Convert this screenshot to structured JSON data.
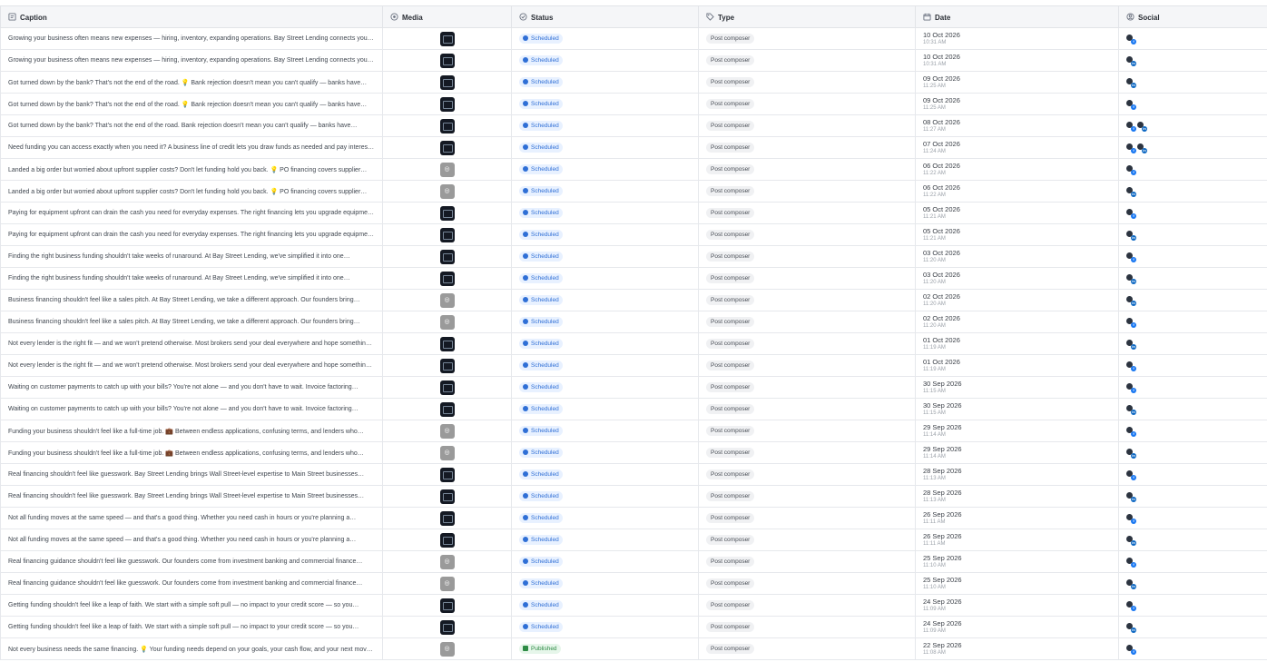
{
  "columns": {
    "caption": "Caption",
    "media": "Media",
    "status": "Status",
    "type": "Type",
    "date": "Date",
    "social": "Social"
  },
  "rows": [
    {
      "caption": "Growing your business often means new expenses — hiring, inventory, expanding operations. Bay Street Lending connects you…",
      "media": "image",
      "status": "Scheduled",
      "type": "Post composer",
      "date": "10 Oct 2026",
      "time": "10:31 AM",
      "social": [
        "facebook"
      ]
    },
    {
      "caption": "Growing your business often means new expenses — hiring, inventory, expanding operations. Bay Street Lending connects you…",
      "media": "image",
      "status": "Scheduled",
      "type": "Post composer",
      "date": "10 Oct 2026",
      "time": "10:31 AM",
      "social": [
        "linkedin"
      ]
    },
    {
      "caption": "Got turned down by the bank? That's not the end of the road. 💡 Bank rejection doesn't mean you can't qualify — banks have…",
      "media": "image",
      "status": "Scheduled",
      "type": "Post composer",
      "date": "09 Oct 2026",
      "time": "11:25 AM",
      "social": [
        "linkedin"
      ]
    },
    {
      "caption": "Got turned down by the bank? That's not the end of the road. 💡 Bank rejection doesn't mean you can't qualify — banks have…",
      "media": "image",
      "status": "Scheduled",
      "type": "Post composer",
      "date": "09 Oct 2026",
      "time": "11:25 AM",
      "social": [
        "facebook"
      ]
    },
    {
      "caption": "Got turned down by the bank? That's not the end of the road. Bank rejection doesn't mean you can't qualify — banks have…",
      "media": "image",
      "status": "Scheduled",
      "type": "Post composer",
      "date": "08 Oct 2026",
      "time": "11:27 AM",
      "social": [
        "facebook",
        "linkedin"
      ]
    },
    {
      "caption": "Need funding you can access exactly when you need it? A business line of credit lets you draw funds as needed and pay interest…",
      "media": "image",
      "status": "Scheduled",
      "type": "Post composer",
      "date": "07 Oct 2026",
      "time": "11:24 AM",
      "social": [
        "facebook",
        "linkedin"
      ]
    },
    {
      "caption": "Landed a big order but worried about upfront supplier costs? Don't let funding hold you back. 💡 PO financing covers supplier…",
      "media": "video",
      "status": "Scheduled",
      "type": "Post composer",
      "date": "06 Oct 2026",
      "time": "11:22 AM",
      "social": [
        "facebook"
      ]
    },
    {
      "caption": "Landed a big order but worried about upfront supplier costs? Don't let funding hold you back. 💡 PO financing covers supplier…",
      "media": "video",
      "status": "Scheduled",
      "type": "Post composer",
      "date": "06 Oct 2026",
      "time": "11:22 AM",
      "social": [
        "linkedin"
      ]
    },
    {
      "caption": "Paying for equipment upfront can drain the cash you need for everyday expenses. The right financing lets you upgrade equipment…",
      "media": "image",
      "status": "Scheduled",
      "type": "Post composer",
      "date": "05 Oct 2026",
      "time": "11:21 AM",
      "social": [
        "facebook"
      ]
    },
    {
      "caption": "Paying for equipment upfront can drain the cash you need for everyday expenses. The right financing lets you upgrade equipment…",
      "media": "image",
      "status": "Scheduled",
      "type": "Post composer",
      "date": "05 Oct 2026",
      "time": "11:21 AM",
      "social": [
        "linkedin"
      ]
    },
    {
      "caption": "Finding the right business funding shouldn't take weeks of runaround. At Bay Street Lending, we've simplified it into one…",
      "media": "image",
      "status": "Scheduled",
      "type": "Post composer",
      "date": "03 Oct 2026",
      "time": "11:20 AM",
      "social": [
        "facebook"
      ]
    },
    {
      "caption": "Finding the right business funding shouldn't take weeks of runaround. At Bay Street Lending, we've simplified it into one…",
      "media": "image",
      "status": "Scheduled",
      "type": "Post composer",
      "date": "03 Oct 2026",
      "time": "11:20 AM",
      "social": [
        "linkedin"
      ]
    },
    {
      "caption": "Business financing shouldn't feel like a sales pitch. At Bay Street Lending, we take a different approach. Our founders bring…",
      "media": "video",
      "status": "Scheduled",
      "type": "Post composer",
      "date": "02 Oct 2026",
      "time": "11:20 AM",
      "social": [
        "linkedin"
      ]
    },
    {
      "caption": "Business financing shouldn't feel like a sales pitch. At Bay Street Lending, we take a different approach. Our founders bring…",
      "media": "video",
      "status": "Scheduled",
      "type": "Post composer",
      "date": "02 Oct 2026",
      "time": "11:20 AM",
      "social": [
        "facebook"
      ]
    },
    {
      "caption": "Not every lender is the right fit — and we won't pretend otherwise. Most brokers send your deal everywhere and hope something…",
      "media": "image",
      "status": "Scheduled",
      "type": "Post composer",
      "date": "01 Oct 2026",
      "time": "11:19 AM",
      "social": [
        "linkedin"
      ]
    },
    {
      "caption": "Not every lender is the right fit — and we won't pretend otherwise. Most brokers send your deal everywhere and hope something…",
      "media": "image",
      "status": "Scheduled",
      "type": "Post composer",
      "date": "01 Oct 2026",
      "time": "11:19 AM",
      "social": [
        "facebook"
      ]
    },
    {
      "caption": "Waiting on customer payments to catch up with your bills? You're not alone — and you don't have to wait. Invoice factoring…",
      "media": "image",
      "status": "Scheduled",
      "type": "Post composer",
      "date": "30 Sep 2026",
      "time": "11:15 AM",
      "social": [
        "facebook"
      ]
    },
    {
      "caption": "Waiting on customer payments to catch up with your bills? You're not alone — and you don't have to wait. Invoice factoring…",
      "media": "image",
      "status": "Scheduled",
      "type": "Post composer",
      "date": "30 Sep 2026",
      "time": "11:15 AM",
      "social": [
        "linkedin"
      ]
    },
    {
      "caption": "Funding your business shouldn't feel like a full-time job. 💼 Between endless applications, confusing terms, and lenders who…",
      "media": "video",
      "status": "Scheduled",
      "type": "Post composer",
      "date": "29 Sep 2026",
      "time": "11:14 AM",
      "social": [
        "facebook"
      ]
    },
    {
      "caption": "Funding your business shouldn't feel like a full-time job. 💼 Between endless applications, confusing terms, and lenders who…",
      "media": "video",
      "status": "Scheduled",
      "type": "Post composer",
      "date": "29 Sep 2026",
      "time": "11:14 AM",
      "social": [
        "linkedin"
      ]
    },
    {
      "caption": "Real financing shouldn't feel like guesswork. Bay Street Lending brings Wall Street-level expertise to Main Street businesses…",
      "media": "image",
      "status": "Scheduled",
      "type": "Post composer",
      "date": "28 Sep 2026",
      "time": "11:13 AM",
      "social": [
        "facebook"
      ]
    },
    {
      "caption": "Real financing shouldn't feel like guesswork. Bay Street Lending brings Wall Street-level expertise to Main Street businesses…",
      "media": "image",
      "status": "Scheduled",
      "type": "Post composer",
      "date": "28 Sep 2026",
      "time": "11:13 AM",
      "social": [
        "linkedin"
      ]
    },
    {
      "caption": "Not all funding moves at the same speed — and that's a good thing. Whether you need cash in hours or you're planning a…",
      "media": "image",
      "status": "Scheduled",
      "type": "Post composer",
      "date": "26 Sep 2026",
      "time": "11:11 AM",
      "social": [
        "facebook"
      ]
    },
    {
      "caption": "Not all funding moves at the same speed — and that's a good thing. Whether you need cash in hours or you're planning a…",
      "media": "image",
      "status": "Scheduled",
      "type": "Post composer",
      "date": "26 Sep 2026",
      "time": "11:11 AM",
      "social": [
        "linkedin"
      ]
    },
    {
      "caption": "Real financing guidance shouldn't feel like guesswork. Our founders come from investment banking and commercial finance…",
      "media": "video",
      "status": "Scheduled",
      "type": "Post composer",
      "date": "25 Sep 2026",
      "time": "11:10 AM",
      "social": [
        "facebook"
      ]
    },
    {
      "caption": "Real financing guidance shouldn't feel like guesswork. Our founders come from investment banking and commercial finance…",
      "media": "video",
      "status": "Scheduled",
      "type": "Post composer",
      "date": "25 Sep 2026",
      "time": "11:10 AM",
      "social": [
        "linkedin"
      ]
    },
    {
      "caption": "Getting funding shouldn't feel like a leap of faith. We start with a simple soft pull — no impact to your credit score — so you…",
      "media": "image",
      "status": "Scheduled",
      "type": "Post composer",
      "date": "24 Sep 2026",
      "time": "11:09 AM",
      "social": [
        "facebook"
      ]
    },
    {
      "caption": "Getting funding shouldn't feel like a leap of faith. We start with a simple soft pull — no impact to your credit score — so you…",
      "media": "image",
      "status": "Scheduled",
      "type": "Post composer",
      "date": "24 Sep 2026",
      "time": "11:09 AM",
      "social": [
        "linkedin"
      ]
    },
    {
      "caption": "Not every business needs the same financing. 💡 Your funding needs depend on your goals, your cash flow, and your next move…",
      "media": "video",
      "status": "Published",
      "type": "Post composer",
      "date": "22 Sep 2026",
      "time": "11:08 AM",
      "social": [
        "facebook"
      ]
    }
  ],
  "colors": {
    "scheduled": "#2f6fd6",
    "published": "#2e8b45",
    "facebook": "#1877f2",
    "linkedin": "#0a66c2"
  },
  "icons": {
    "caption": "caption-icon",
    "media": "media-icon",
    "status": "status-icon",
    "type": "tag-icon",
    "date": "calendar-icon",
    "social": "social-icon"
  }
}
